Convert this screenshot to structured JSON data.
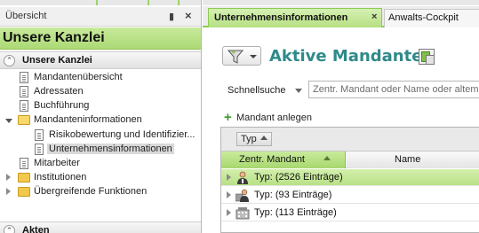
{
  "left_panel": {
    "header_title": "Übersicht",
    "kanzlei_title": "Unsere Kanzlei",
    "section_kanzlei": "Unsere Kanzlei",
    "section_akten": "Akten",
    "tree": [
      {
        "label": "Mandantenübersicht",
        "kind": "doc"
      },
      {
        "label": "Adressaten",
        "kind": "doc"
      },
      {
        "label": "Buchführung",
        "kind": "doc"
      },
      {
        "label": "Mandanteninformationen",
        "kind": "folder-open"
      },
      {
        "label": "Risikobewertung und Identifizier...",
        "kind": "doc"
      },
      {
        "label": "Unternehmensinformationen",
        "kind": "doc",
        "selected": true
      },
      {
        "label": "Mitarbeiter",
        "kind": "doc"
      },
      {
        "label": "Institutionen",
        "kind": "folder"
      },
      {
        "label": "Übergreifende Funktionen",
        "kind": "folder"
      }
    ]
  },
  "tabs": {
    "active": "Unternehmensinformationen",
    "inactive": "Anwalts-Cockpit"
  },
  "main": {
    "title": "Aktive Mandanten",
    "quicksearch_label": "Schnellsuche",
    "search_placeholder": "Zentr. Mandant oder Name oder altem",
    "add_client_label": "Mandant anlegen",
    "group_by_chip": "Typ",
    "columns": {
      "zentr": "Zentr. Mandant",
      "name": "Name"
    },
    "groups": [
      {
        "label": "Typ:  (2526 Einträge)",
        "icon": "person-icon",
        "selected": true
      },
      {
        "label": "Typ:  (93 Einträge)",
        "icon": "persons-group-icon",
        "selected": false
      },
      {
        "label": "Typ:  (113 Einträge)",
        "icon": "company-icon",
        "selected": false
      }
    ]
  },
  "colors": {
    "accent_green": "#b7e083",
    "title_teal": "#2f8a8a"
  }
}
